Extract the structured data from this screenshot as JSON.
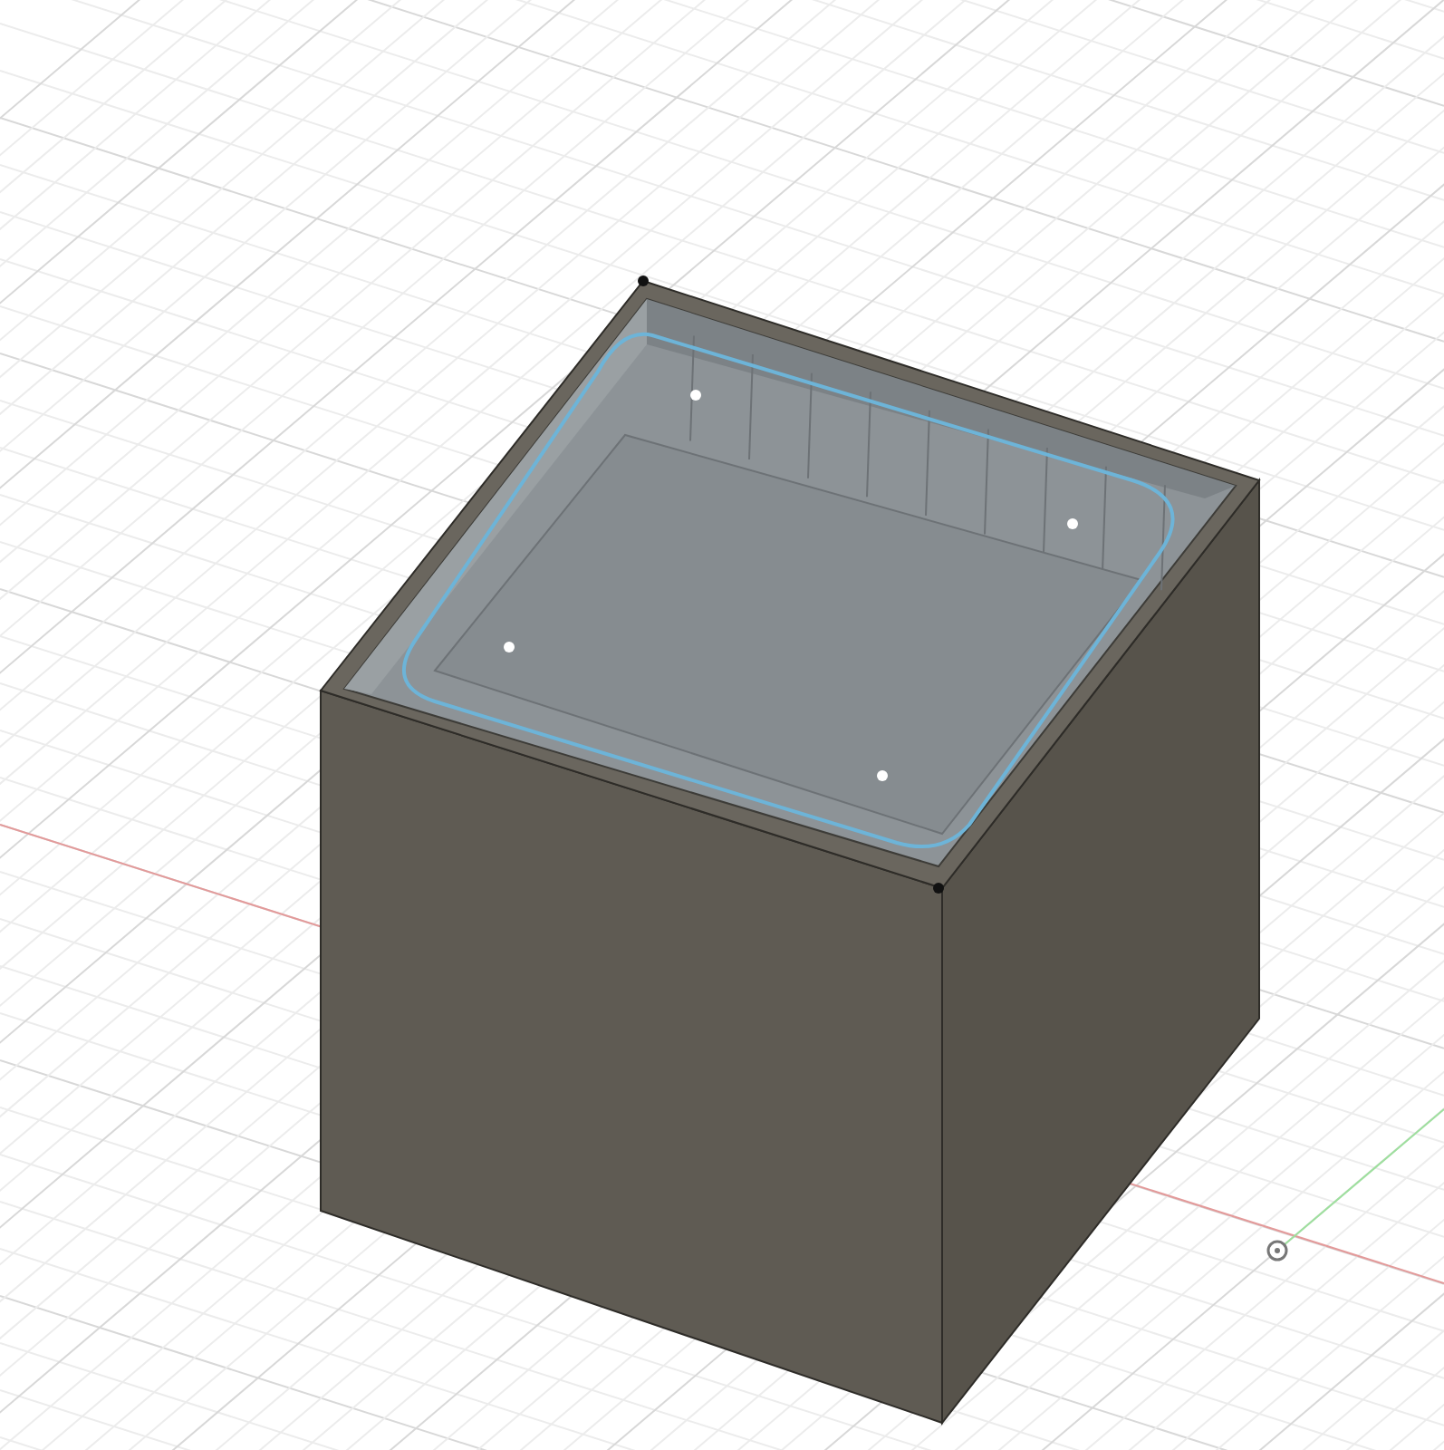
{
  "viewport": {
    "kind": "model"
  },
  "sketch_profile": {
    "selected": true
  }
}
